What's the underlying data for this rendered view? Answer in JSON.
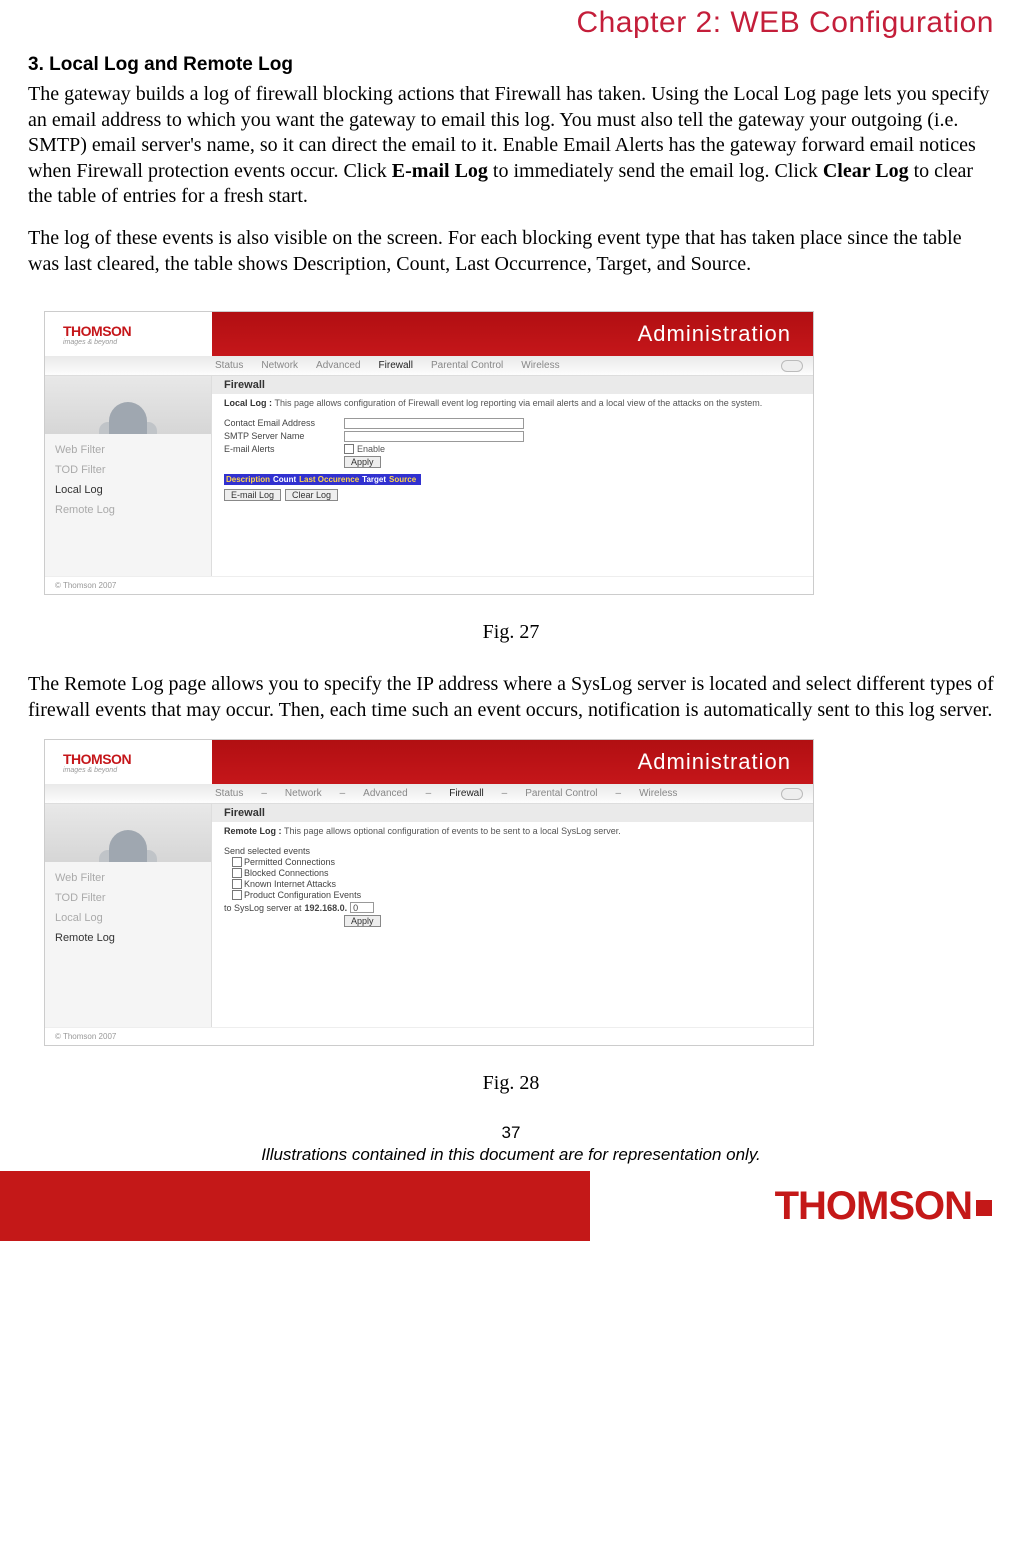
{
  "chapter_title": "Chapter 2: WEB Configuration",
  "section_heading": "3. Local Log and Remote Log",
  "para1_a": "The gateway builds a log of firewall blocking actions that Firewall has taken. Using the Local Log page lets you specify an email address to which you want the gateway to email this log. You must also tell the gateway your outgoing (i.e. SMTP) email server's name, so it can direct the email to it. Enable Email Alerts has the gateway forward email notices when Firewall protection events occur. Click ",
  "para1_bold1": "E-mail Log",
  "para1_b": " to immediately send the email log. Click ",
  "para1_bold2": "Clear Log",
  "para1_c": " to clear the table of entries for a fresh start.",
  "para2": "The log of these events is also visible on the screen. For each blocking event type that has taken place since the table was last cleared, the table shows Description, Count, Last Occurrence, Target, and Source.",
  "fig27_caption": "Fig. 27",
  "para3": "The Remote Log page allows you to specify the IP address where a SysLog server is located and select different types of firewall events that may occur. Then, each time such an event occurs, notification is automatically sent to this log server.",
  "fig28_caption": "Fig. 28",
  "page_number": "37",
  "disclaimer": "Illustrations contained in this document are for representation only.",
  "footer_brand": "THOMSON",
  "shared": {
    "logo": "THOMSON",
    "logo_tag": "images & beyond",
    "admin": "Administration",
    "footer_copyright": "© Thomson   2007"
  },
  "fig27": {
    "nav": {
      "status": "Status",
      "network": "Network",
      "advanced": "Advanced",
      "firewall": "Firewall",
      "parental": "Parental Control",
      "wireless": "Wireless"
    },
    "side": {
      "webfilter": "Web Filter",
      "todfilter": "TOD Filter",
      "locallog": "Local Log",
      "remotelog": "Remote Log"
    },
    "section_title": "Firewall",
    "desc_label": "Local Log : ",
    "desc": "This page allows configuration of Firewall event log reporting via email alerts and a local view of the attacks on the system.",
    "labels": {
      "contact": "Contact Email Address",
      "smtp": "SMTP Server Name",
      "alerts": "E-mail Alerts",
      "enable": "Enable"
    },
    "apply_btn": "Apply",
    "table": {
      "desc": "Description",
      "count": "Count",
      "last": "Last Occurence",
      "target": "Target",
      "source": "Source"
    },
    "email_btn": "E-mail Log",
    "clear_btn": "Clear Log"
  },
  "fig28": {
    "nav": {
      "status": "Status",
      "network": "Network",
      "advanced": "Advanced",
      "firewall": "Firewall",
      "parental": "Parental Control",
      "wireless": "Wireless"
    },
    "side": {
      "webfilter": "Web Filter",
      "todfilter": "TOD Filter",
      "locallog": "Local Log",
      "remotelog": "Remote Log"
    },
    "section_title": "Firewall",
    "desc_label": "Remote Log : ",
    "desc": "This page allows optional configuration of events to be sent to a local SysLog server.",
    "send_label": "Send selected events",
    "events": {
      "permitted": "Permitted Connections",
      "blocked": "Blocked Connections",
      "attacks": "Known Internet Attacks",
      "product": "Product Configuration Events"
    },
    "ip_prefix": "to SysLog server at ",
    "ip_fixed": "192.168.0.",
    "ip_last": "0",
    "apply_btn": "Apply"
  }
}
